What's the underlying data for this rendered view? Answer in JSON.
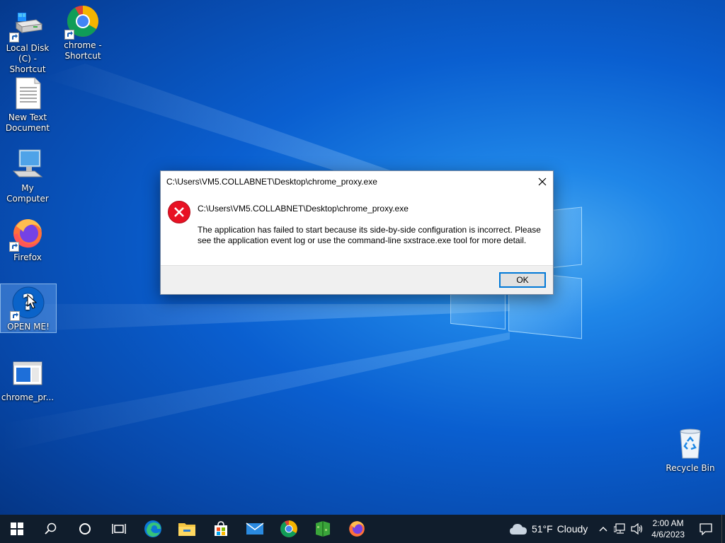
{
  "desktop": {
    "icons": [
      {
        "label": "Local Disk (C) - Shortcut",
        "icon": "drive-icon"
      },
      {
        "label": "chrome - Shortcut",
        "icon": "chrome-icon"
      },
      {
        "label": "New Text Document",
        "icon": "text-document-icon"
      },
      {
        "label": "My Computer",
        "icon": "computer-icon"
      },
      {
        "label": "Firefox",
        "icon": "firefox-icon"
      },
      {
        "label": "OPEN ME!",
        "icon": "help-icon"
      },
      {
        "label": "chrome_pr...",
        "icon": "window-app-icon"
      },
      {
        "label": "Recycle Bin",
        "icon": "recycle-bin-icon"
      }
    ]
  },
  "dialog": {
    "title": "C:\\Users\\VM5.COLLABNET\\Desktop\\chrome_proxy.exe",
    "heading": "C:\\Users\\VM5.COLLABNET\\Desktop\\chrome_proxy.exe",
    "message": "The application has failed to start because its side-by-side configuration is incorrect. Please see the application event log or use the command-line sxstrace.exe tool for more detail.",
    "ok_label": "OK"
  },
  "taskbar": {
    "apps": [
      "start-icon",
      "search-icon",
      "cortana-icon",
      "task-view-icon",
      "edge-icon",
      "file-explorer-icon",
      "store-icon",
      "mail-icon",
      "chrome-icon",
      "minecraft-icon",
      "firefox-icon"
    ],
    "weather": {
      "temp": "51°F",
      "condition": "Cloudy"
    },
    "clock": {
      "time": "2:00 AM",
      "date": "4/6/2023"
    }
  },
  "colors": {
    "accent": "#0078d7",
    "error": "#e81123",
    "taskbar": "#101d2c"
  }
}
